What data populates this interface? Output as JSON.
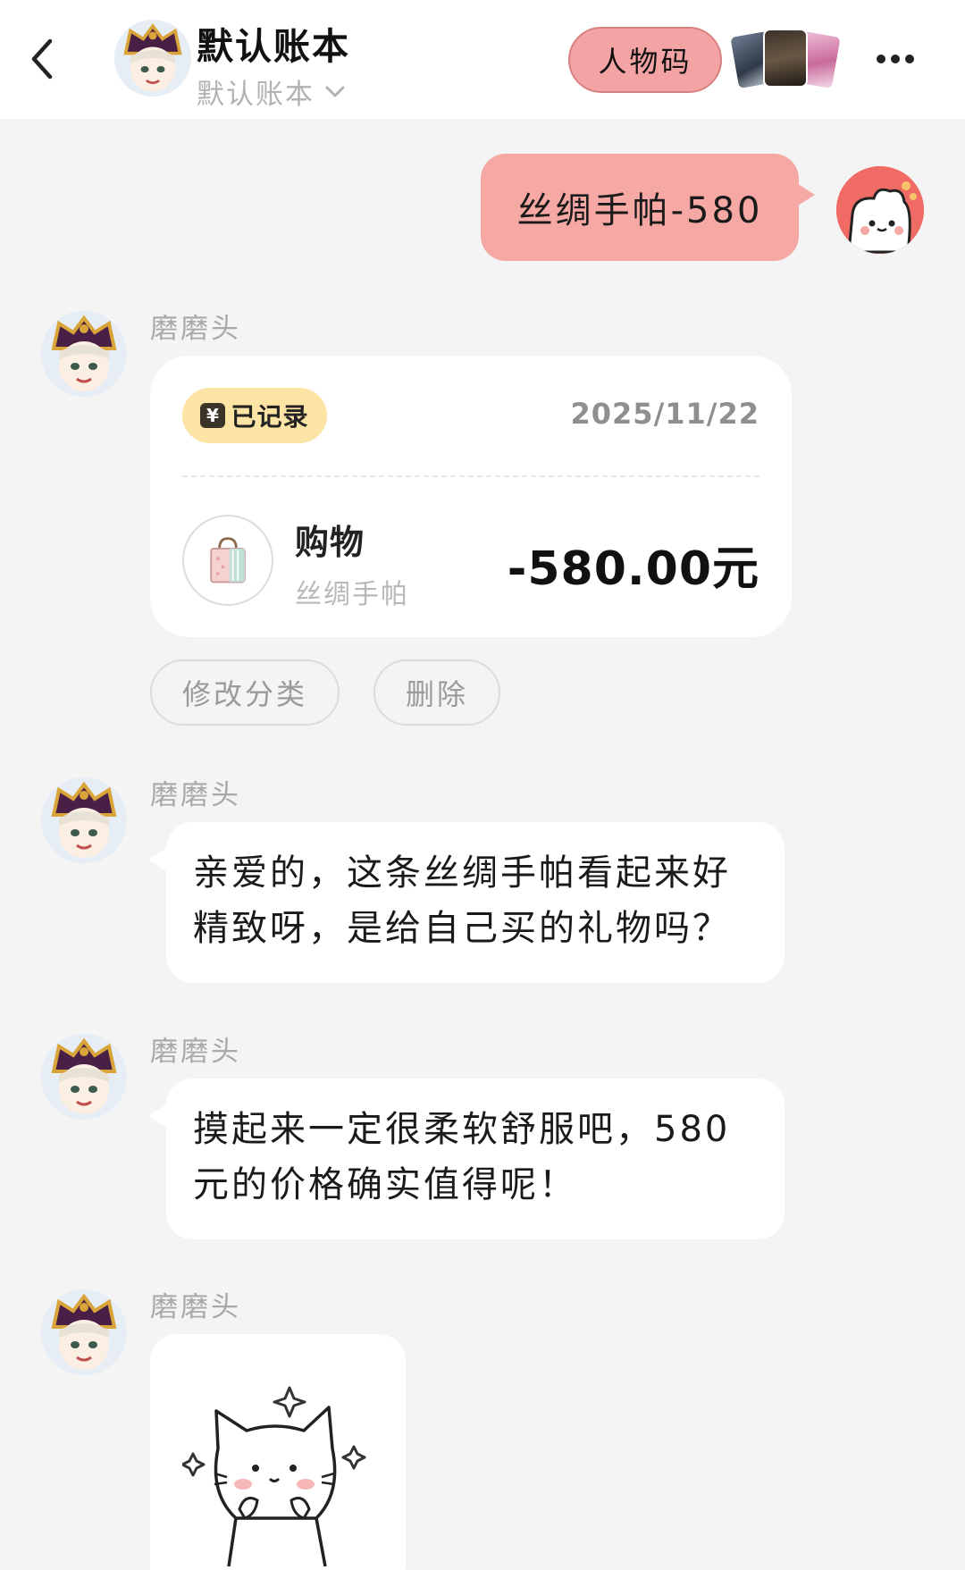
{
  "header": {
    "title": "默认账本",
    "subtitle": "默认账本",
    "persona_button": "人物码"
  },
  "messages": {
    "user_message": "丝绸手帕-580",
    "sender": "磨磨头",
    "record": {
      "badge": "已记录",
      "yen_symbol": "¥",
      "date": "2025/11/22",
      "category": "购物",
      "note": "丝绸手帕",
      "amount": "-580.00元"
    },
    "actions": {
      "change_category": "修改分类",
      "delete": "删除"
    },
    "reply_1_line1": "亲爱的，这条丝绸手帕看起来好",
    "reply_1_line2": "精致呀，是给自己买的礼物吗？",
    "reply_2_line1": "摸起来一定很柔软舒服吧，580",
    "reply_2_line2": "元的价格确实值得呢！"
  },
  "colors": {
    "user_bubble": "#f5a8a4",
    "persona_button": "#f3a3a3",
    "recorded_badge": "#fce4a4",
    "background": "#f4f4f4"
  },
  "icons": {
    "back": "chevron-left-icon",
    "expand": "chevron-down-icon",
    "more": "more-dots-icon",
    "category": "shopping-bag-icon",
    "sticker": "cat-sticker"
  }
}
